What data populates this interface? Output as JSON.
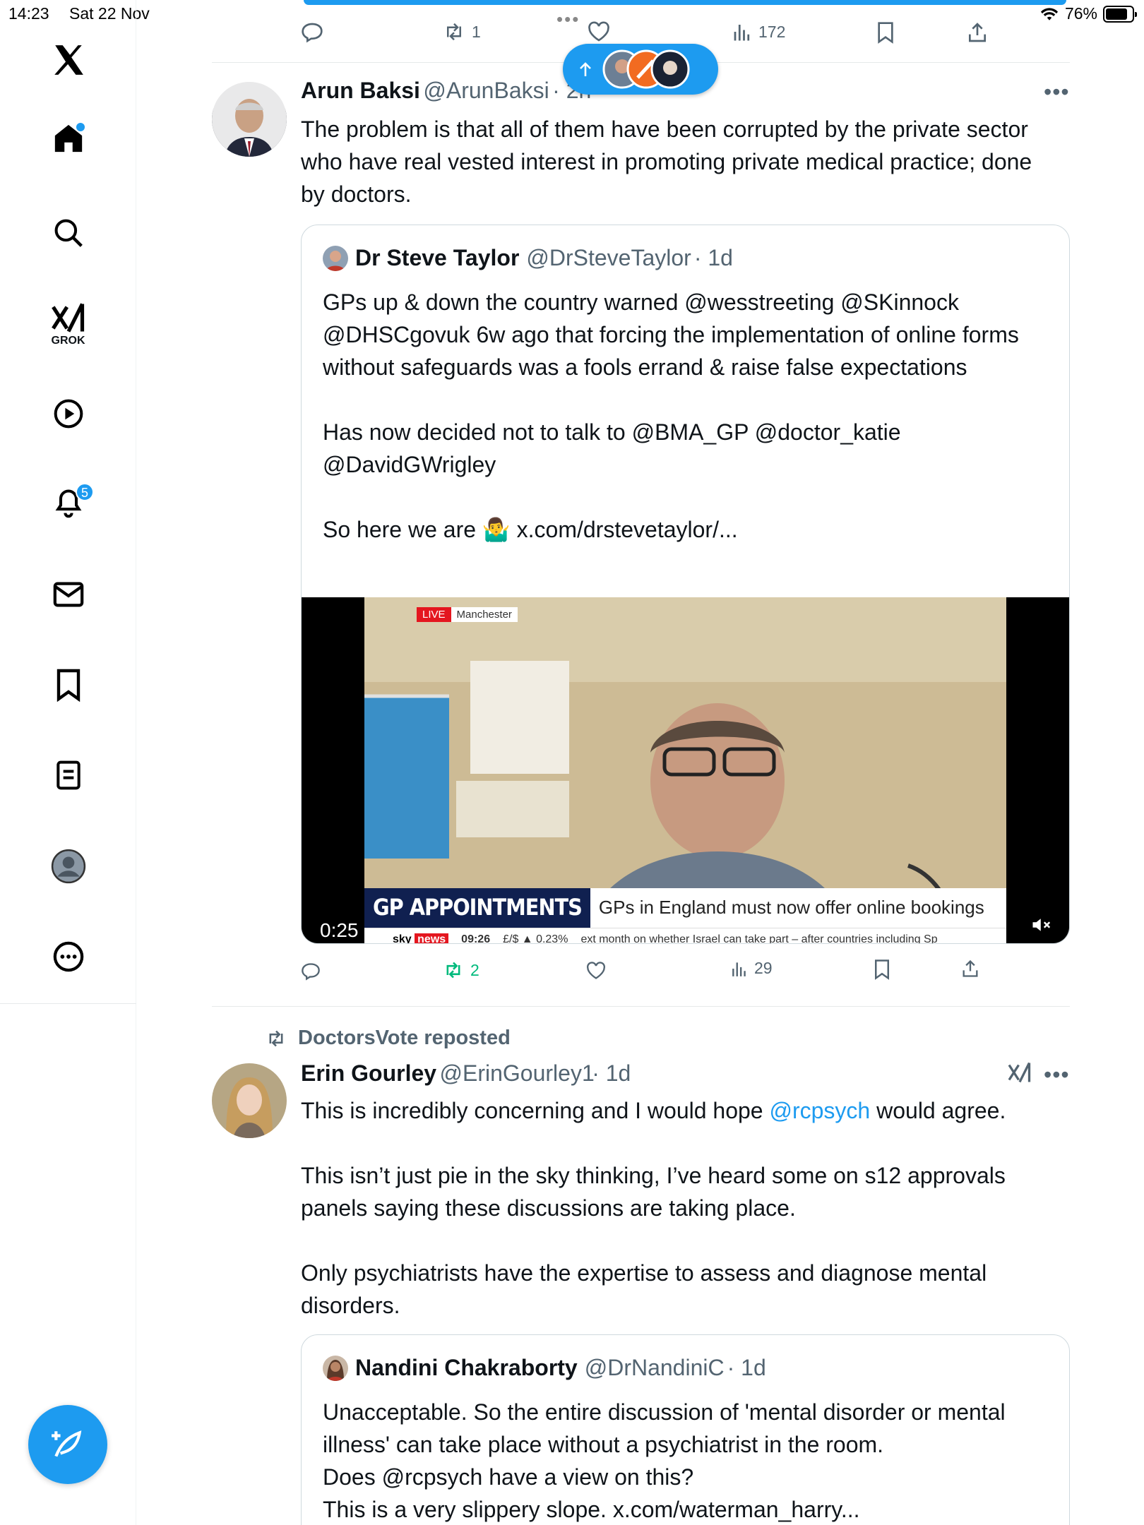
{
  "status_bar": {
    "time": "14:23",
    "date": "Sat 22 Nov",
    "battery": "76%"
  },
  "sidebar": {
    "logo": "x-logo-icon",
    "grok_label": "GROK",
    "notifications_count": "5"
  },
  "prev_post_actions": {
    "retweets": "1",
    "views": "172"
  },
  "post1": {
    "author_name": "Arun Baksi",
    "author_handle": "@ArunBaksi",
    "age": "· 2h",
    "text": "The problem is that all of them have been corrupted by the private sector who have real vested interest in promoting private medical practice; done by doctors.",
    "quote": {
      "author_name": "Dr Steve Taylor",
      "author_handle": "@DrSteveTaylor",
      "age": "· 1d",
      "text": "GPs up & down the country warned @wesstreeting @SKinnock @DHSCgovuk 6w ago that forcing the implementation of online forms without safeguards was a fools errand & raise false expectations\n\nHas now decided not to talk to @BMA_GP @doctor_katie @DavidGWrigley\n\nSo here we are 🤷‍♂️ x.com/drstevetaylor/...",
      "video": {
        "live_label": "LIVE",
        "location": "Manchester",
        "headline_key": "GP APPOINTMENTS",
        "headline": "GPs in England must now offer online bookings",
        "ticker_brand": "sky",
        "ticker_news": "news",
        "ticker_time": "09:26",
        "ticker_fx": "£/$ ▲ 0.23%",
        "ticker_text": "ext month on whether Israel can take part – after countries including Sp",
        "duration": "0:25"
      }
    },
    "actions": {
      "retweets": "2",
      "views": "29"
    }
  },
  "post2": {
    "repost_label": "DoctorsVote reposted",
    "author_name": "Erin Gourley",
    "author_handle": "@ErinGourley1",
    "age": "· 1d",
    "text_before": "This is incredibly concerning and I would hope ",
    "mention": "@rcpsych",
    "text_after": " would agree.",
    "text_rest": "This isn’t just pie in the sky thinking, I’ve heard some on s12 approvals panels saying these discussions are taking place.\n\nOnly psychiatrists have the expertise to assess and diagnose mental disorders.",
    "quote": {
      "author_name": "Nandini Chakraborty",
      "author_handle": "@DrNandiniC",
      "age": "· 1d",
      "text": "Unacceptable. So the entire discussion of 'mental disorder or mental illness' can take place without a psychiatrist in the room.\nDoes @rcpsych have a view on this?\nThis is a very slippery slope. x.com/waterman_harry..."
    }
  },
  "colors": {
    "accent": "#1d9bf0",
    "repost_green": "#00ba7c",
    "muted": "#536471"
  }
}
